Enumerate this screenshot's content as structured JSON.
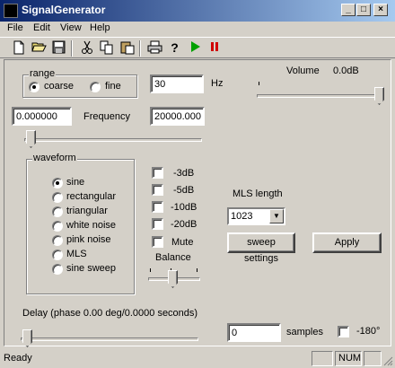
{
  "window": {
    "title": "SignalGenerator"
  },
  "menu": [
    "File",
    "Edit",
    "View",
    "Help"
  ],
  "toolbar": {
    "icons": [
      "new-file-icon",
      "open-folder-icon",
      "save-icon",
      "cut-icon",
      "copy-icon",
      "paste-icon",
      "print-icon",
      "help-icon",
      "play-icon",
      "pause-icon"
    ],
    "play_color": "#00a000",
    "pause_color": "#d00000"
  },
  "range": {
    "legend": "range",
    "options": [
      "coarse",
      "fine"
    ],
    "selected": "coarse"
  },
  "hz_value": "30",
  "hz_label": "Hz",
  "volume": {
    "label": "Volume",
    "value": "0.0dB",
    "level": 1.0
  },
  "frequency": {
    "label": "Frequency",
    "min": "0.000000",
    "max": "20000.000",
    "slider_fraction": 0.0
  },
  "waveform": {
    "legend": "waveform",
    "options": [
      "sine",
      "rectangular",
      "triangular",
      "white noise",
      "pink noise",
      "MLS",
      "sine sweep"
    ],
    "selected": "sine"
  },
  "attenuation": [
    {
      "label": "-3dB",
      "checked": false
    },
    {
      "label": "-5dB",
      "checked": false
    },
    {
      "label": "-10dB",
      "checked": false
    },
    {
      "label": "-20dB",
      "checked": false
    },
    {
      "label": "Mute",
      "checked": false
    }
  ],
  "balance": {
    "label": "Balance",
    "level": 0.5
  },
  "mls": {
    "label": "MLS length",
    "value": "1023"
  },
  "buttons": {
    "sweep": "sweep settings",
    "apply": "Apply"
  },
  "delay": {
    "label": "Delay (phase  0.00 deg/0.0000 seconds)",
    "samples_value": "0",
    "samples_label": "samples",
    "invert_label": "-180°",
    "slider_fraction": 0.0
  },
  "status": {
    "text": "Ready",
    "num": "NUM"
  }
}
